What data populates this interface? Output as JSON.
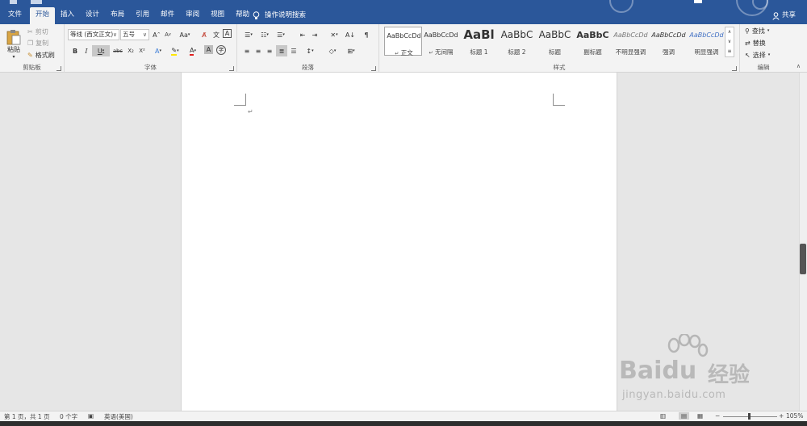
{
  "tabs": [
    "文件",
    "开始",
    "插入",
    "设计",
    "布局",
    "引用",
    "邮件",
    "审阅",
    "视图",
    "帮助"
  ],
  "active_tab": "开始",
  "tell_me": "操作说明搜索",
  "share": "共享",
  "clipboard": {
    "group_label": "剪贴板",
    "paste": "粘贴",
    "cut": "剪切",
    "copy": "复制",
    "format_painter": "格式刷"
  },
  "font": {
    "group_label": "字体",
    "font_name": "等线 (西文正文)",
    "font_size": "五号",
    "grow": "A",
    "shrink": "A",
    "case": "Aa",
    "bold": "B",
    "italic": "I",
    "underline": "U",
    "strike": "abc",
    "subscript": "X₂",
    "superscript": "X²"
  },
  "paragraph": {
    "group_label": "段落"
  },
  "styles": {
    "group_label": "样式",
    "items": [
      {
        "preview": "AaBbCcDd",
        "name": "正文"
      },
      {
        "preview": "AaBbCcDd",
        "name": "无间隔"
      },
      {
        "preview": "AaBl",
        "name": "标题 1"
      },
      {
        "preview": "AaBbC",
        "name": "标题 2"
      },
      {
        "preview": "AaBbC",
        "name": "标题"
      },
      {
        "preview": "AaBbC",
        "name": "副标题"
      },
      {
        "preview": "AaBbCcDd",
        "name": "不明显强调"
      },
      {
        "preview": "AaBbCcDd",
        "name": "强调"
      },
      {
        "preview": "AaBbCcDd",
        "name": "明显强调"
      }
    ]
  },
  "editing": {
    "group_label": "编辑",
    "find": "查找",
    "replace": "替换",
    "select": "选择"
  },
  "status": {
    "page": "第 1 页，共 1 页",
    "words": "0 个字",
    "language": "英语(美国)",
    "zoom": "105%",
    "zoom_minus": "−",
    "zoom_plus": "+"
  },
  "watermark": {
    "brand": "Bai",
    "brand2": "du",
    "cn": "经验",
    "url": "jingyan.baidu.com"
  },
  "colors": {
    "accent": "#2b579a",
    "ribbon": "#f3f3f3",
    "workspace": "#e6e6e6"
  }
}
